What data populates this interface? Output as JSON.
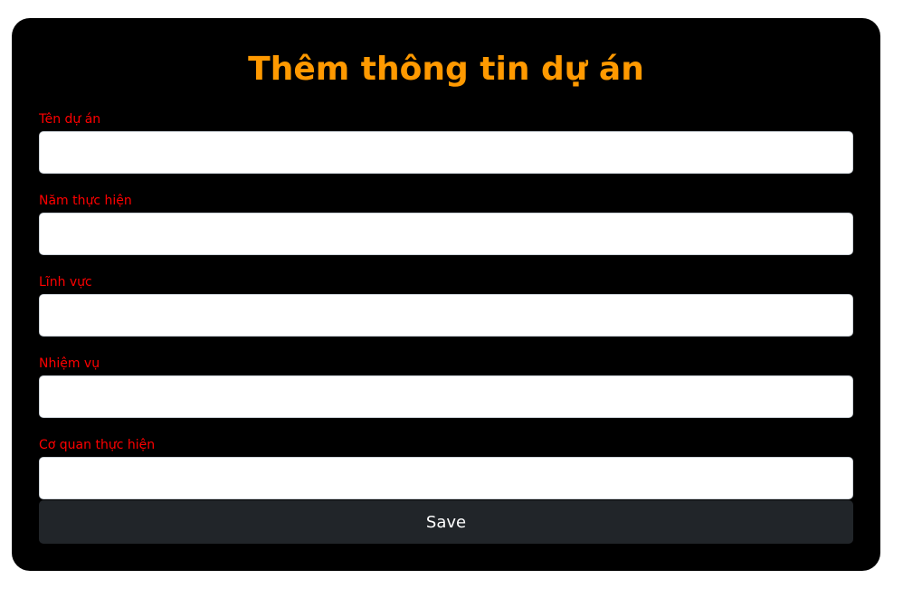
{
  "form": {
    "title": "Thêm thông tin dự án",
    "fields": [
      {
        "label": "Tên dự án",
        "value": "",
        "placeholder": ""
      },
      {
        "label": "Năm thực hiện",
        "value": "",
        "placeholder": ""
      },
      {
        "label": "Lĩnh vực",
        "value": "",
        "placeholder": ""
      },
      {
        "label": "Nhiệm vụ",
        "value": "",
        "placeholder": ""
      },
      {
        "label": "Cơ quan thực hiện",
        "value": "",
        "placeholder": ""
      }
    ],
    "save_label": "Save"
  },
  "colors": {
    "title": "#ff9900",
    "label": "#ff0000",
    "card_background": "#000000",
    "button_background": "#212529",
    "button_text": "#ffffff"
  }
}
